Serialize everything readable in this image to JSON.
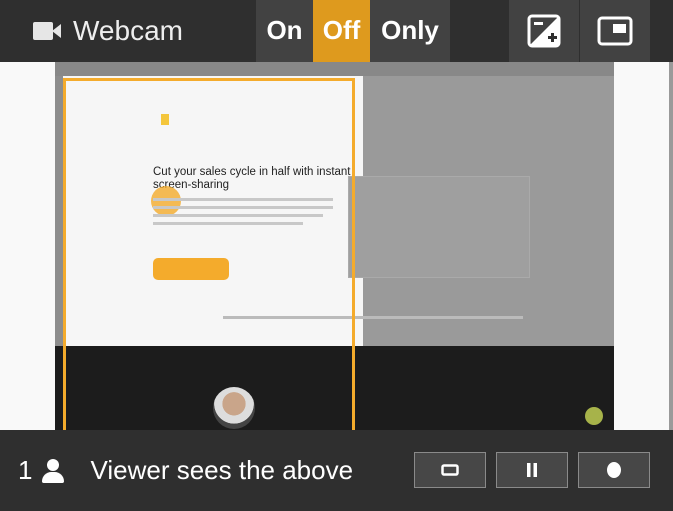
{
  "header": {
    "webcam_label": "Webcam",
    "webcam_icon": "video-camera-icon",
    "modes": [
      {
        "label": "On",
        "selected": false
      },
      {
        "label": "Off",
        "selected": true
      },
      {
        "label": "Only",
        "selected": false
      }
    ],
    "accent_color": "#de9a1e",
    "exposure_icon": "exposure-icon",
    "pip_icon": "picture-in-picture-icon"
  },
  "preview": {
    "headline": "Cut your sales cycle in half with instant screen-sharing",
    "highlight_color": "#f4ab2c"
  },
  "footer": {
    "viewer_count": "1",
    "viewer_icon": "person-icon",
    "status_text": "Viewer sees the above",
    "buttons": [
      {
        "name": "window-button",
        "icon": "window-icon"
      },
      {
        "name": "pause-button",
        "icon": "pause-icon"
      },
      {
        "name": "record-button",
        "icon": "record-icon"
      }
    ]
  }
}
